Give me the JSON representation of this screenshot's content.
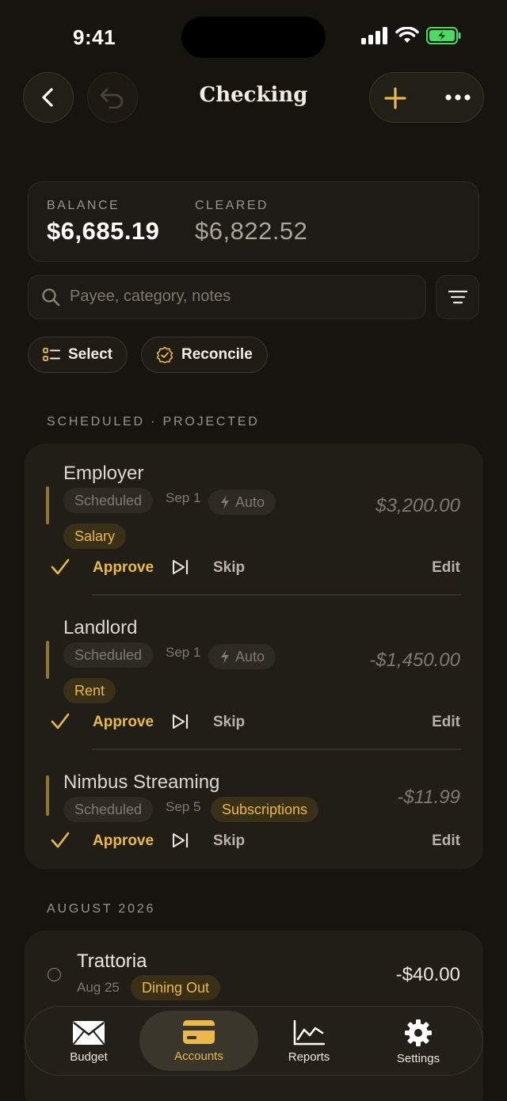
{
  "status_bar": {
    "time": "9:41"
  },
  "nav": {
    "title": "Checking"
  },
  "balance": {
    "balance_label": "BALANCE",
    "balance_value": "$6,685.19",
    "cleared_label": "CLEARED",
    "cleared_value": "$6,822.52"
  },
  "search": {
    "placeholder": "Payee, category, notes"
  },
  "actions": {
    "select_label": "Select",
    "reconcile_label": "Reconcile"
  },
  "scheduled_section": {
    "header": "SCHEDULED · PROJECTED",
    "items": [
      {
        "payee": "Employer",
        "status": "Scheduled",
        "date": "Sep 1",
        "auto": "Auto",
        "category": "Salary",
        "amount": "$3,200.00",
        "approve": "Approve",
        "skip": "Skip",
        "edit": "Edit"
      },
      {
        "payee": "Landlord",
        "status": "Scheduled",
        "date": "Sep 1",
        "auto": "Auto",
        "category": "Rent",
        "amount": "-$1,450.00",
        "approve": "Approve",
        "skip": "Skip",
        "edit": "Edit"
      },
      {
        "payee": "Nimbus Streaming",
        "status": "Scheduled",
        "date": "Sep 5",
        "category": "Subscriptions",
        "amount": "-$11.99",
        "approve": "Approve",
        "skip": "Skip",
        "edit": "Edit"
      }
    ]
  },
  "august_section": {
    "header": "AUGUST 2026",
    "transactions": [
      {
        "payee": "Trattoria",
        "date": "Aug 25",
        "category": "Dining Out",
        "amount": "-$40.00"
      }
    ]
  },
  "tabbar": {
    "tabs": [
      {
        "label": "Budget",
        "icon": "envelope-icon"
      },
      {
        "label": "Accounts",
        "icon": "credit-card-icon",
        "active": true
      },
      {
        "label": "Reports",
        "icon": "chart-icon"
      },
      {
        "label": "Settings",
        "icon": "gear-icon"
      }
    ]
  },
  "colors": {
    "accent": "#e9b94a",
    "background": "#16140f",
    "card": "#211e17",
    "battery": "#4cd964"
  }
}
